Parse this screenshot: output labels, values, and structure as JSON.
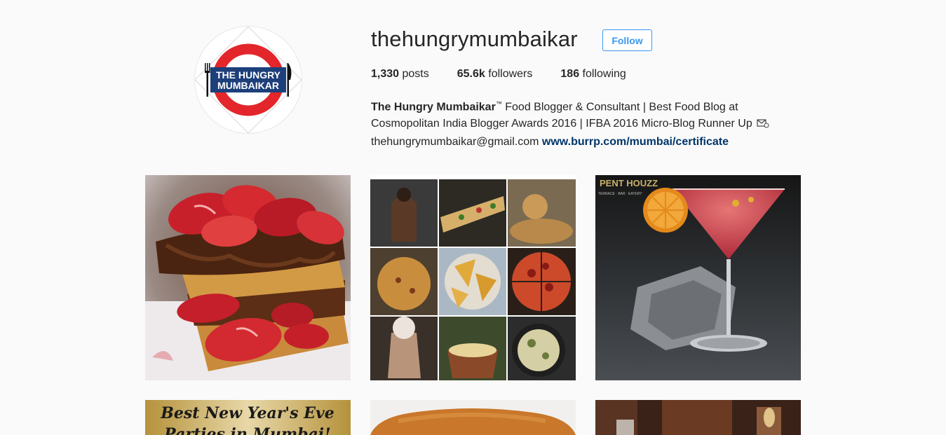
{
  "profile": {
    "username": "thehungrymumbaikar",
    "follow_label": "Follow",
    "avatar_text_line1": "THE HUNGRY",
    "avatar_text_line2": "MUMBAIKAR",
    "stats": {
      "posts_count": "1,330",
      "posts_label": "posts",
      "followers_count": "65.6k",
      "followers_label": "followers",
      "following_count": "186",
      "following_label": "following"
    },
    "bio": {
      "full_name": "The Hungry Mumbaikar",
      "trademark": "™",
      "text_1": " Food Blogger & Consultant | Best Food Blog at Cosmopolitan India Blogger Awards 2016 | IFBA 2016 Micro-Blog Runner Up ",
      "email": "thehungrymumbaikar@gmail.com ",
      "link": "www.burrp.com/mumbai/certificate"
    }
  },
  "posts": [
    {
      "subject": "strawberry-nutella-waffle-stack"
    },
    {
      "subject": "food-collage-nine-dishes"
    },
    {
      "subject": "red-cocktail-martini-glass",
      "overlay_text": "PENT HOUZZ",
      "overlay_sub": "TERRACE · BAR · EATERY"
    },
    {
      "subject": "new-years-eve-banner",
      "overlay_text_1": "Best New Year's Eve",
      "overlay_text_2": "Parties in Mumbai!"
    },
    {
      "subject": "bun-closeup"
    },
    {
      "subject": "restaurant-interior"
    }
  ],
  "colors": {
    "follow_blue": "#3897f0",
    "link_blue": "#003569",
    "avatar_red": "#e3262b",
    "avatar_navy": "#1d3f7a"
  }
}
